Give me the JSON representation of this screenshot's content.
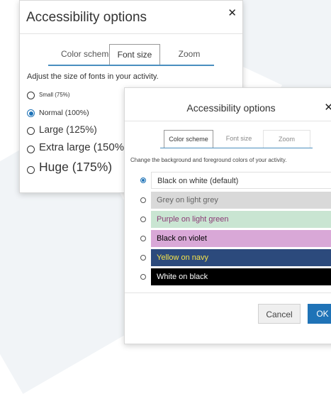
{
  "dialog_font": {
    "title": "Accessibility options",
    "close_icon": "close-icon",
    "tabs": [
      {
        "label": "Color scheme"
      },
      {
        "label": "Font size"
      },
      {
        "label": "Zoom"
      }
    ],
    "active_tab": "Font size",
    "description": "Adjust the size of fonts in your activity.",
    "options": [
      {
        "label": "Small (75%)"
      },
      {
        "label": "Normal (100%)"
      },
      {
        "label": "Large (125%)"
      },
      {
        "label": "Extra large (150%)"
      },
      {
        "label": "Huge (175%)"
      }
    ],
    "selected_option": "Normal (100%)"
  },
  "dialog_color": {
    "title": "Accessibility options",
    "close_icon": "close-icon",
    "tabs": [
      {
        "label": "Color scheme"
      },
      {
        "label": "Font size"
      },
      {
        "label": "Zoom"
      }
    ],
    "active_tab": "Color scheme",
    "description": "Change the background and foreground colors of your activity.",
    "schemes": [
      {
        "label": "Black on white (default)",
        "bg": "#ffffff",
        "fg": "#000000"
      },
      {
        "label": "Grey on light grey",
        "bg": "#d9d9d9",
        "fg": "#666666"
      },
      {
        "label": "Purple on light green",
        "bg": "#c9e5d2",
        "fg": "#8b3a76"
      },
      {
        "label": "Black on violet",
        "bg": "#d9a8d7",
        "fg": "#000000"
      },
      {
        "label": "Yellow on navy",
        "bg": "#2c4a7c",
        "fg": "#f6e34a"
      },
      {
        "label": "White on black",
        "bg": "#000000",
        "fg": "#ffffff"
      }
    ],
    "selected_scheme": "Black on white (default)",
    "cancel_label": "Cancel",
    "ok_label": "OK"
  },
  "colors": {
    "accent": "#1f73b7"
  }
}
